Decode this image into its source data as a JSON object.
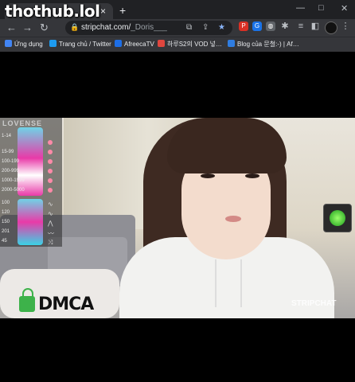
{
  "browser": {
    "watermark": "thothub.lol",
    "tab_close": "×",
    "new_tab": "+",
    "window_controls": [
      "—",
      "□",
      "✕"
    ],
    "nav": {
      "back": "←",
      "forward": "→",
      "reload": "↻"
    },
    "url_host": "stripchat.com/",
    "url_path": "_Doris___",
    "extensions_icons": [
      "share-icon",
      "star-icon",
      "extension-icon",
      "puzzle-icon",
      "sidebar-icon",
      "avatar",
      "menu-icon"
    ]
  },
  "bookmarks": [
    {
      "label": "Ứng dụng",
      "color": "#4285f4"
    },
    {
      "label": "Trang chủ / Twitter",
      "color": "#1d9bf0"
    },
    {
      "label": "AfreecaTV",
      "color": "#1d6ee6"
    },
    {
      "label": "하루S2의 VOD 넣…",
      "color": "#e0463e"
    },
    {
      "label": "Blog của 문철:-) | Af…",
      "color": "#2f7de1"
    }
  ],
  "overlay": {
    "title": "LOVENSE",
    "tiers": [
      "1-14",
      "15-99",
      "100-199",
      "200-999",
      "1000-1999",
      "2000-5000",
      "100",
      "120",
      "150",
      "201",
      "45"
    ]
  },
  "stream": {
    "dmca": "DMCA",
    "brand": "STRIPCHAT"
  }
}
